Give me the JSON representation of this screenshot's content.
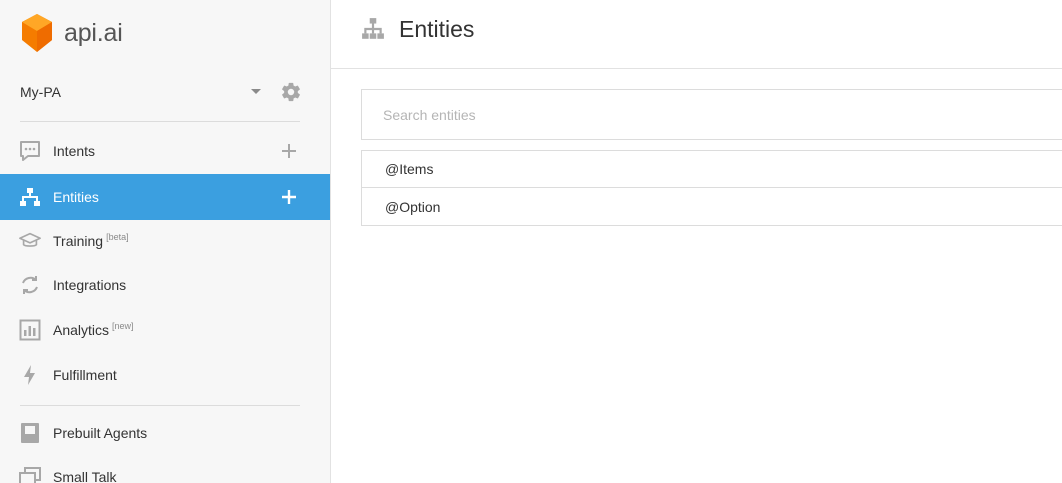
{
  "brand": {
    "name": "api.ai",
    "logo_color": "#f57c00"
  },
  "agent": {
    "name": "My-PA"
  },
  "sidebar": {
    "items": [
      {
        "label": "Intents",
        "sup": ""
      },
      {
        "label": "Entities",
        "sup": ""
      },
      {
        "label": "Training",
        "sup": "[beta]"
      },
      {
        "label": "Integrations",
        "sup": ""
      },
      {
        "label": "Analytics",
        "sup": "[new]"
      },
      {
        "label": "Fulfillment",
        "sup": ""
      },
      {
        "label": "Prebuilt Agents",
        "sup": ""
      },
      {
        "label": "Small Talk",
        "sup": ""
      }
    ],
    "active_color": "#3b9fe0"
  },
  "header": {
    "title": "Entities"
  },
  "search": {
    "placeholder": "Search entities",
    "value": ""
  },
  "entities": [
    {
      "label": "@Items"
    },
    {
      "label": "@Option"
    }
  ]
}
